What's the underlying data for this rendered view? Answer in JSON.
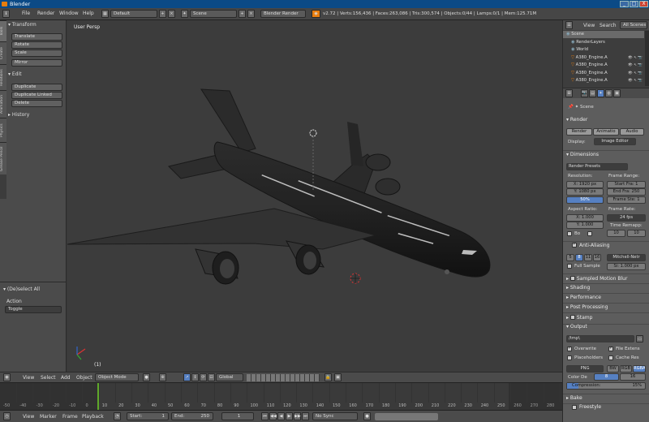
{
  "window": {
    "title": "Blender",
    "min": "_",
    "max": "□",
    "close": "X"
  },
  "infobar": {
    "menus": [
      "File",
      "Render",
      "Window",
      "Help"
    ],
    "layout": "Default",
    "scene": "Scene",
    "engine": "Blender Render",
    "stats": "v2.72 | Verts:156,436 | Faces:263,086 | Tris:300,574 | Objects:0/44 | Lamps:0/1 | Mem:125.71M"
  },
  "toolshelf": {
    "tabs": [
      "Tools",
      "Create",
      "Relations",
      "Animation",
      "Physics",
      "Grease Pencil"
    ],
    "transform_header": "Transform",
    "transform_buttons": [
      "Translate",
      "Rotate",
      "Scale"
    ],
    "mirror": "Mirror",
    "edit_header": "Edit",
    "edit_buttons": [
      "Duplicate",
      "Duplicate Linked",
      "Delete"
    ],
    "history_header": "History",
    "operator_header": "(De)select All",
    "action_label": "Action",
    "action_value": "Toggle"
  },
  "viewport": {
    "label": "User Persp",
    "frame_label": "(1)"
  },
  "view3d_header": {
    "menus": [
      "View",
      "Select",
      "Add",
      "Object"
    ],
    "mode": "Object Mode",
    "orientation": "Global"
  },
  "timeline": {
    "ruler": [
      "-50",
      "-40",
      "-30",
      "-20",
      "-10",
      "0",
      "10",
      "20",
      "30",
      "40",
      "50",
      "60",
      "70",
      "80",
      "90",
      "100",
      "110",
      "120",
      "130",
      "140",
      "150",
      "160",
      "170",
      "180",
      "190",
      "200",
      "210",
      "220",
      "230",
      "240",
      "250",
      "260",
      "270",
      "280"
    ],
    "menus": [
      "View",
      "Marker",
      "Frame",
      "Playback"
    ],
    "start": "Start:",
    "start_val": "1",
    "end": "End:",
    "end_val": "250",
    "current": "1",
    "sync": "No Sync"
  },
  "outliner": {
    "view": "View",
    "search": "Search",
    "filter": "All Scenes",
    "items": [
      "Scene",
      "RenderLayers",
      "World",
      "A380_Engine.A",
      "A380_Engine.A",
      "A380_Engine.A",
      "A380_Engine.A"
    ]
  },
  "properties": {
    "context": "Scene",
    "render_header": "Render",
    "render_btn": "Render",
    "anim_btn": "Animatio",
    "audio_btn": "Audio",
    "display_label": "Display:",
    "display_value": "Image Editor",
    "dimensions_header": "Dimensions",
    "presets": "Render Presets",
    "resolution_label": "Resolution:",
    "res_x": "X: 1920 px",
    "res_y": "Y: 1080 px",
    "res_pct": "50%",
    "frame_range_label": "Frame Range:",
    "start_frame": "Start Fra: 1",
    "end_frame": "End Fra: 250",
    "frame_step": "Frame Ste: 1",
    "aspect_label": "Aspect Ratio:",
    "aspect_x": "X: 1.000",
    "aspect_y": "Y: 1.000",
    "frame_rate_label": "Frame Rate:",
    "frame_rate": "24 fps",
    "time_remap_label": "Time Remapp:",
    "remap_old": "10",
    "remap_new": "10",
    "border_label": "Bo",
    "aa_header": "Anti-Aliasing",
    "aa_samples": [
      "5",
      "8",
      "11",
      "16"
    ],
    "aa_filter": "Mitchell-Netr",
    "full_sample": "Full Sample",
    "filter_size": "Si: 1.000 px",
    "collapsed": [
      "Sampled Motion Blur",
      "Shading",
      "Performance",
      "Post Processing",
      "Stamp"
    ],
    "output_header": "Output",
    "output_path": "/tmp\\",
    "overwrite": "Overwrite",
    "file_ext": "File Extens",
    "placeholders": "Placeholders",
    "cache": "Cache Res",
    "format": "PNG",
    "color_modes": [
      "BW",
      "RGB",
      "RGBA"
    ],
    "color_depth_label": "Color De",
    "depths": [
      "8",
      "16"
    ],
    "compression": "Compression:",
    "compression_val": "15%",
    "bake_header": "Bake",
    "freestyle_header": "Freestyle"
  },
  "colors": {
    "accent": "#5680c2",
    "selected_orange": "#e87d0d",
    "frame_green": "#5fa82a"
  }
}
